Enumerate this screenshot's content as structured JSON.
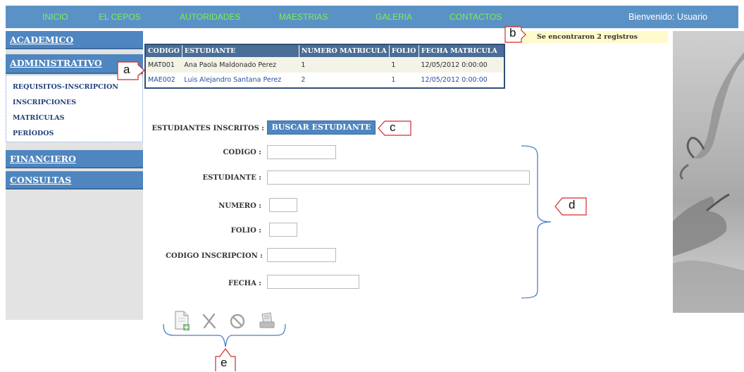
{
  "nav": {
    "items": [
      "INICIO",
      "EL CEPOS",
      "AUTORIDADES",
      "MAESTRIAS",
      "GALERIA",
      "CONTACTOS"
    ],
    "welcome": "Bienvenido: Usuario"
  },
  "sidebar": {
    "academico": "ACADEMICO",
    "administrativo": "ADMINISTRATIVO",
    "submenu": [
      "REQUISITOS-INSCRIPCION",
      "INSCRIPCIONES",
      "MATRÍCULAS",
      "PERÍODOS"
    ],
    "financiero": "FINANCIERO",
    "consultas": "CONSULTAS"
  },
  "results": {
    "headers": [
      "CODIGO",
      "ESTUDIANTE",
      "NUMERO MATRICULA",
      "FOLIO",
      "FECHA MATRICULA"
    ],
    "rows": [
      [
        "MAT001",
        "Ana Paola Maldonado Perez",
        "1",
        "1",
        "12/05/2012 0:00:00"
      ],
      [
        "MAE002",
        "Luis Alejandro Santana Perez",
        "2",
        "1",
        "12/05/2012 0:00:00"
      ]
    ]
  },
  "banner": "Se encontraron 2 registros",
  "form": {
    "inscritos_label": "ESTUDIANTES INSCRITOS :",
    "search_button": "BUSCAR ESTUDIANTE",
    "fields": [
      {
        "label": "CODIGO :",
        "value": ""
      },
      {
        "label": "ESTUDIANTE :",
        "value": ""
      },
      {
        "label": "NUMERO :",
        "value": ""
      },
      {
        "label": "FOLIO :",
        "value": ""
      },
      {
        "label": "CODIGO INSCRIPCION :",
        "value": ""
      },
      {
        "label": "FECHA :",
        "value": ""
      }
    ]
  },
  "toolbar": {
    "icons": [
      "new-document-icon",
      "delete-x-icon",
      "cancel-icon",
      "print-icon"
    ]
  },
  "callouts": [
    "a",
    "b",
    "c",
    "d",
    "e"
  ],
  "colors": {
    "nav_bg": "#5b92c6",
    "nav_text": "#7df04a",
    "menu_bg": "#4f86c0",
    "table_header": "#4a6e96",
    "banner_bg": "#fffbcc"
  }
}
